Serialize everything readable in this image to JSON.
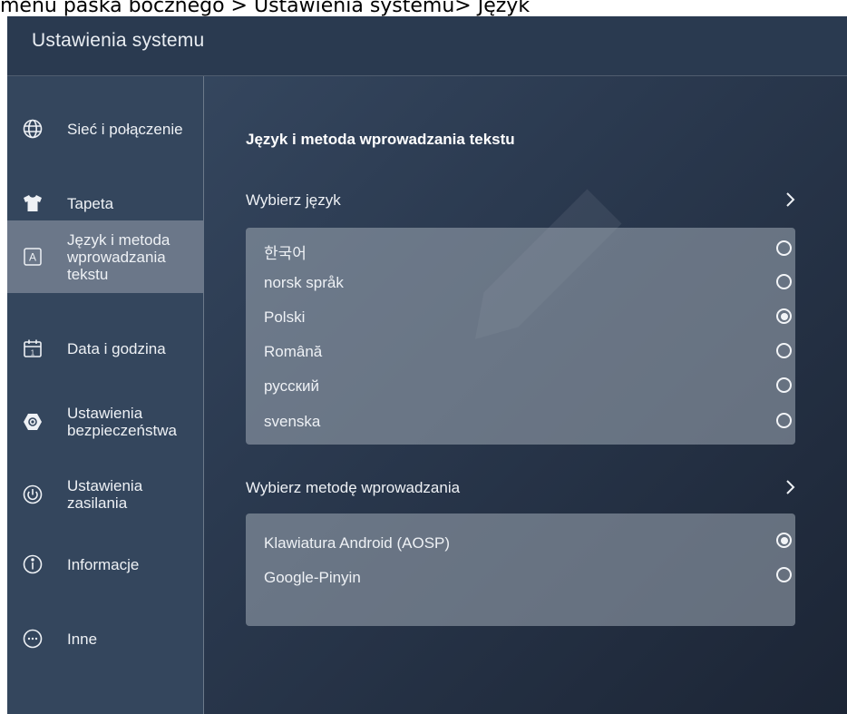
{
  "caption": "menu paska bocznego > Ustawienia systemu> Język",
  "window_title": "Ustawienia systemu",
  "sidebar": {
    "items": [
      {
        "label": "Sieć i połączenie",
        "icon": "globe-icon",
        "active": false
      },
      {
        "label": "Tapeta",
        "icon": "shirt-icon",
        "active": false
      },
      {
        "label": "Język i metoda wprowadzania tekstu",
        "icon": "letter-a-icon",
        "active": true
      },
      {
        "label": "Data i godzina",
        "icon": "calendar-icon",
        "active": false
      },
      {
        "label": "Ustawienia bezpieczeństwa",
        "icon": "shield-icon",
        "active": false
      },
      {
        "label": "Ustawienia zasilania",
        "icon": "power-icon",
        "active": false
      },
      {
        "label": "Informacje",
        "icon": "info-icon",
        "active": false
      },
      {
        "label": "Inne",
        "icon": "more-icon",
        "active": false
      }
    ]
  },
  "main": {
    "section_title": "Język i metoda wprowadzania tekstu",
    "language": {
      "label": "Wybierz język",
      "options": [
        {
          "label": "한국어",
          "selected": false
        },
        {
          "label": "norsk språk",
          "selected": false
        },
        {
          "label": "Polski",
          "selected": true
        },
        {
          "label": "Română",
          "selected": false
        },
        {
          "label": "русский",
          "selected": false
        },
        {
          "label": "svenska",
          "selected": false
        }
      ]
    },
    "input_method": {
      "label": "Wybierz metodę wprowadzania",
      "options": [
        {
          "label": "Klawiatura Android (AOSP)",
          "selected": true
        },
        {
          "label": "Google-Pinyin",
          "selected": false
        }
      ]
    }
  },
  "colors": {
    "sidebar_bg": "#34465d",
    "active_item": "#6b7789",
    "panel_bg": "#8b95a3",
    "text": "#eef1f5"
  }
}
